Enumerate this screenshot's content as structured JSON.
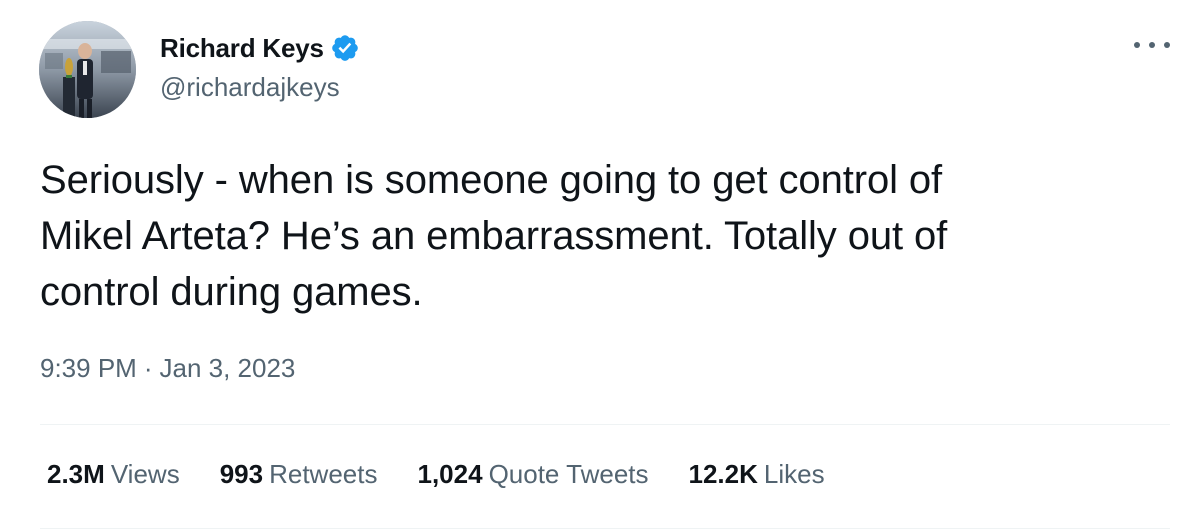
{
  "author": {
    "display_name": "Richard Keys",
    "handle": "@richardajkeys",
    "verified": true,
    "avatar_icon": "profile-photo",
    "verified_icon": "verified-badge-icon"
  },
  "tweet": {
    "text": "Seriously - when is someone going to get control of\nMikel Arteta? He’s an embarrassment. Totally out of\ncontrol during games.",
    "time": "9:39 PM",
    "separator": "·",
    "date": "Jan 3, 2023"
  },
  "stats": {
    "views": {
      "value": "2.3M",
      "label": "Views"
    },
    "retweets": {
      "value": "993",
      "label": "Retweets"
    },
    "quote_tweets": {
      "value": "1,024",
      "label": "Quote Tweets"
    },
    "likes": {
      "value": "12.2K",
      "label": "Likes"
    }
  },
  "menu": {
    "icon": "more-options-icon"
  },
  "colors": {
    "text_primary": "#0f1419",
    "text_secondary": "#536471",
    "verified_blue": "#1d9bf0",
    "divider": "#eff3f4"
  }
}
